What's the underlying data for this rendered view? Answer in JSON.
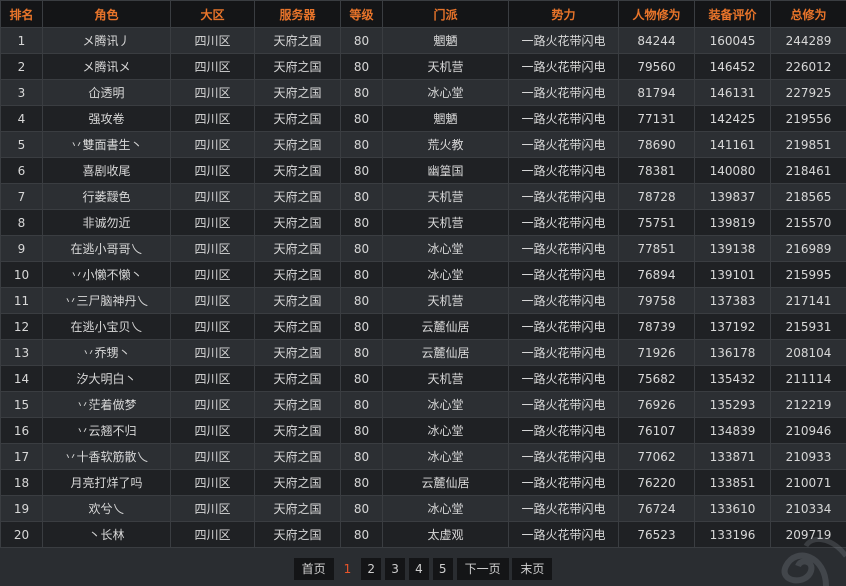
{
  "table": {
    "headers": [
      "排名",
      "角色",
      "大区",
      "服务器",
      "等级",
      "门派",
      "势力",
      "人物修为",
      "装备评价",
      "总修为"
    ],
    "rows": [
      [
        "1",
        "メ腾讯丿",
        "四川区",
        "天府之国",
        "80",
        "魍魉",
        "一路火花带闪电",
        "84244",
        "160045",
        "244289"
      ],
      [
        "2",
        "メ腾讯メ",
        "四川区",
        "天府之国",
        "80",
        "天机营",
        "一路火花带闪电",
        "79560",
        "146452",
        "226012"
      ],
      [
        "3",
        "仚透明",
        "四川区",
        "天府之国",
        "80",
        "冰心堂",
        "一路火花带闪电",
        "81794",
        "146131",
        "227925"
      ],
      [
        "4",
        "强攻卷",
        "四川区",
        "天府之国",
        "80",
        "魍魉",
        "一路火花带闪电",
        "77131",
        "142425",
        "219556"
      ],
      [
        "5",
        "丷雙面書生丶",
        "四川区",
        "天府之国",
        "80",
        "荒火教",
        "一路火花带闪电",
        "78690",
        "141161",
        "219851"
      ],
      [
        "6",
        "喜剧收尾",
        "四川区",
        "天府之国",
        "80",
        "幽篁国",
        "一路火花带闪电",
        "78381",
        "140080",
        "218461"
      ],
      [
        "7",
        "行萎靉色",
        "四川区",
        "天府之国",
        "80",
        "天机营",
        "一路火花带闪电",
        "78728",
        "139837",
        "218565"
      ],
      [
        "8",
        "非诚勿近",
        "四川区",
        "天府之国",
        "80",
        "天机营",
        "一路火花带闪电",
        "75751",
        "139819",
        "215570"
      ],
      [
        "9",
        "在逃小哥哥乀",
        "四川区",
        "天府之国",
        "80",
        "冰心堂",
        "一路火花带闪电",
        "77851",
        "139138",
        "216989"
      ],
      [
        "10",
        "丷小懒不懒丶",
        "四川区",
        "天府之国",
        "80",
        "冰心堂",
        "一路火花带闪电",
        "76894",
        "139101",
        "215995"
      ],
      [
        "11",
        "丷三尸脑神丹乀",
        "四川区",
        "天府之国",
        "80",
        "天机营",
        "一路火花带闪电",
        "79758",
        "137383",
        "217141"
      ],
      [
        "12",
        "在逃小宝贝乀",
        "四川区",
        "天府之国",
        "80",
        "云麓仙居",
        "一路火花带闪电",
        "78739",
        "137192",
        "215931"
      ],
      [
        "13",
        "丷乔甥丶",
        "四川区",
        "天府之国",
        "80",
        "云麓仙居",
        "一路火花带闪电",
        "71926",
        "136178",
        "208104"
      ],
      [
        "14",
        "汐大明白丶",
        "四川区",
        "天府之国",
        "80",
        "天机营",
        "一路火花带闪电",
        "75682",
        "135432",
        "211114"
      ],
      [
        "15",
        "丷茫着做梦",
        "四川区",
        "天府之国",
        "80",
        "冰心堂",
        "一路火花带闪电",
        "76926",
        "135293",
        "212219"
      ],
      [
        "16",
        "丷云翘不归",
        "四川区",
        "天府之国",
        "80",
        "冰心堂",
        "一路火花带闪电",
        "76107",
        "134839",
        "210946"
      ],
      [
        "17",
        "丷十香软筋散乀",
        "四川区",
        "天府之国",
        "80",
        "冰心堂",
        "一路火花带闪电",
        "77062",
        "133871",
        "210933"
      ],
      [
        "18",
        "月亮打烊了吗",
        "四川区",
        "天府之国",
        "80",
        "云麓仙居",
        "一路火花带闪电",
        "76220",
        "133851",
        "210071"
      ],
      [
        "19",
        "欢兮乀",
        "四川区",
        "天府之国",
        "80",
        "冰心堂",
        "一路火花带闪电",
        "76724",
        "133610",
        "210334"
      ],
      [
        "20",
        "丶长林",
        "四川区",
        "天府之国",
        "80",
        "太虚观",
        "一路火花带闪电",
        "76523",
        "133196",
        "209719"
      ]
    ]
  },
  "pager": {
    "first": "首页",
    "pages": [
      "1",
      "2",
      "3",
      "4",
      "5"
    ],
    "current": "1",
    "next": "下一页",
    "last": "末页"
  },
  "colors": {
    "header_text": "#e8742a",
    "current_page": "#e8542a",
    "background": "#2a2d31"
  }
}
